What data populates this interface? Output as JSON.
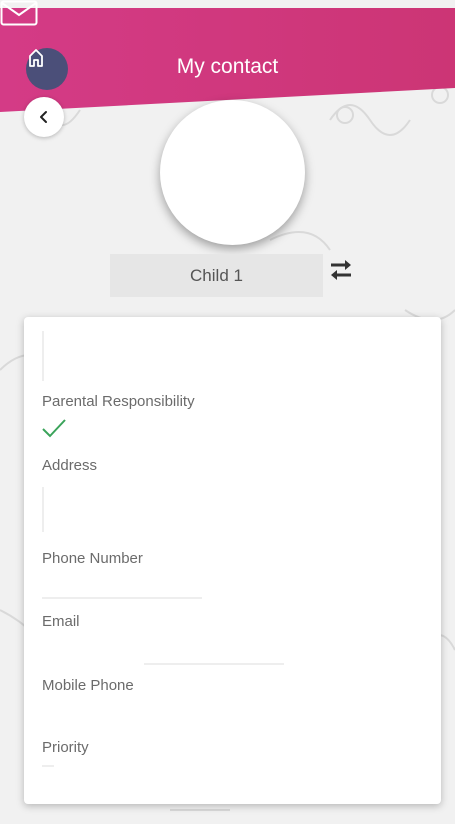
{
  "header": {
    "title": "My contact",
    "colors": {
      "brand": "#d43b86",
      "home_button": "#4b4f79"
    },
    "icons": {
      "home": "home-icon",
      "mail": "mail-icon",
      "back": "chevron-left-icon",
      "swap": "swap-icon"
    }
  },
  "child_selector": {
    "value": "Child 1"
  },
  "contact_card": {
    "fields": [
      {
        "label": "Parental Responsibility",
        "value_icon": "checkmark-icon"
      },
      {
        "label": "Address"
      },
      {
        "label": "Phone Number"
      },
      {
        "label": "Email"
      },
      {
        "label": "Mobile Phone"
      },
      {
        "label": "Priority"
      }
    ],
    "check_color": "#3aa35a"
  }
}
